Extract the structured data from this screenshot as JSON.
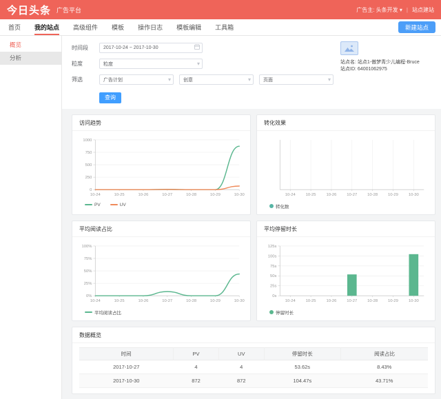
{
  "header": {
    "logo": "今日头条",
    "product": "广告平台",
    "advertiser_label": "广告主: 头条开发",
    "caret": "▾",
    "divider": "|",
    "site_link": "站点建站"
  },
  "nav": {
    "items": [
      "首页",
      "我的站点",
      "高级组件",
      "模板",
      "操作日志",
      "模板编辑",
      "工具箱"
    ],
    "active": "我的站点",
    "new_site_button": "新建站点"
  },
  "sidebar": {
    "items": [
      {
        "label": "概览",
        "active": true
      },
      {
        "label": "分析",
        "active": false
      }
    ]
  },
  "filters": {
    "date_label": "时间段",
    "date_value": "2017-10-24 ~ 2017-10-30",
    "granularity_label": "粒度",
    "granularity_value": "粒度",
    "filter_label": "筛选",
    "selects": [
      "广告计划",
      "创意",
      "页面"
    ],
    "query_button": "查询"
  },
  "site_info": {
    "name_label": "站点名:",
    "name": "站点1-傲梦青少儿编程-Bruce",
    "id_label": "站点ID:",
    "id": "64001062975"
  },
  "colors": {
    "brand_red": "#ef6459",
    "primary_blue": "#409eff",
    "nav_button_blue": "#4c9ef8",
    "chart_green": "#5bb78f",
    "chart_orange": "#ef8a5a",
    "chart_teal": "#56b5a5"
  },
  "chart_data": [
    {
      "name": "visit-trend",
      "title": "访问趋势",
      "type": "line",
      "categories": [
        "10-24",
        "10-25",
        "10-26",
        "10-27",
        "10-28",
        "10-29",
        "10-30"
      ],
      "series": [
        {
          "name": "PV",
          "color": "#5bb78f",
          "values": [
            0,
            0,
            0,
            4,
            0,
            0,
            872
          ]
        },
        {
          "name": "UV",
          "color": "#ef8a5a",
          "values": [
            0,
            0,
            0,
            4,
            0,
            0,
            72
          ]
        }
      ],
      "y_ticks": [
        0,
        250,
        500,
        750,
        1000
      ],
      "y_suffix": "",
      "ylim": [
        0,
        1000
      ],
      "grid": "horizontal",
      "legend": "line",
      "legend_position": "bottom"
    },
    {
      "name": "conversion-effect",
      "title": "转化效果",
      "type": "line",
      "categories": [
        "10-24",
        "10-25",
        "10-26",
        "10-27",
        "10-28",
        "10-29",
        "10-30"
      ],
      "series": [
        {
          "name": "转化数",
          "color": "#56b5a5",
          "values": []
        }
      ],
      "y_ticks": [],
      "y_suffix": "",
      "ylim": [
        0,
        1
      ],
      "grid": "vertical",
      "legend": "dot",
      "legend_position": "bottom"
    },
    {
      "name": "avg-read-ratio",
      "title": "平均阅读占比",
      "type": "line",
      "categories": [
        "10-24",
        "10-25",
        "10-26",
        "10-27",
        "10-28",
        "10-29",
        "10-30"
      ],
      "series": [
        {
          "name": "平均阅读占比",
          "color": "#5bb78f",
          "values": [
            0,
            0,
            0,
            8.43,
            0,
            0,
            43.71
          ]
        }
      ],
      "y_ticks": [
        0,
        25,
        50,
        75,
        100
      ],
      "y_suffix": "%",
      "ylim": [
        0,
        100
      ],
      "grid": "horizontal",
      "legend": "line",
      "legend_position": "bottom"
    },
    {
      "name": "avg-stay-duration",
      "title": "平均停留时长",
      "type": "bar",
      "categories": [
        "10-24",
        "10-25",
        "10-26",
        "10-27",
        "10-28",
        "10-29",
        "10-30"
      ],
      "series": [
        {
          "name": "停留时长",
          "color": "#5bb78f",
          "values": [
            null,
            null,
            null,
            53.62,
            null,
            null,
            104.47
          ]
        }
      ],
      "y_ticks": [
        0,
        25,
        50,
        75,
        100,
        125
      ],
      "y_suffix": "s",
      "ylim": [
        0,
        125
      ],
      "grid": "horizontal",
      "legend": "dot",
      "legend_position": "bottom"
    }
  ],
  "table": {
    "title": "数据概览",
    "headers": [
      "时间",
      "PV",
      "UV",
      "停留时长",
      "阅读占比"
    ],
    "rows": [
      [
        "2017-10-27",
        "4",
        "4",
        "53.62s",
        "8.43%"
      ],
      [
        "2017-10-30",
        "872",
        "872",
        "104.47s",
        "43.71%"
      ]
    ]
  }
}
